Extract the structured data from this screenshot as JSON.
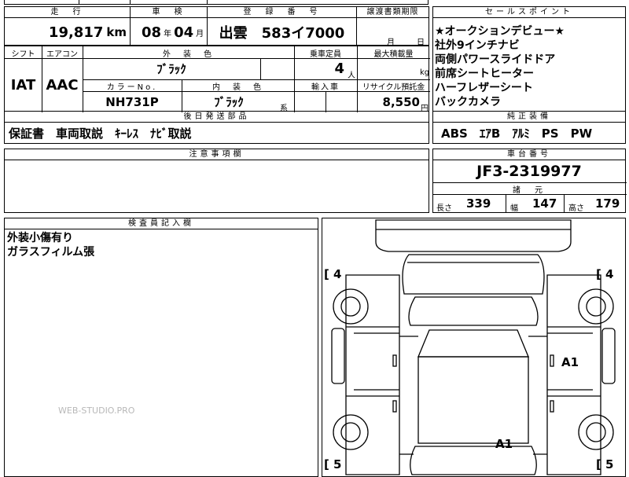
{
  "headers": {
    "mileage": "走　行",
    "inspection": "車　検",
    "registration": "登　録　番　号",
    "transfer_deadline": "譲渡書類期限",
    "sales_points": "セールスポイント",
    "shift": "シフト",
    "aircon": "エアコン",
    "exterior_color": "外　装　色",
    "capacity": "乗車定員",
    "max_load": "最大積載量",
    "color_no": "カラーNo.",
    "interior_color": "内　装　色",
    "import": "輸入車",
    "recycle": "リサイクル預託金",
    "later_parts": "後日発送部品",
    "genuine_equipment": "純正装備",
    "caution": "注意事項欄",
    "chassis_no": "車台番号",
    "specs": "諸　元",
    "inspector": "検査員記入欄"
  },
  "values": {
    "mileage": "19,817",
    "mileage_unit": "km",
    "inspection_year": "08",
    "year_unit": "年",
    "inspection_month": "04",
    "month_unit": "月",
    "registration": "出雲　583イ7000",
    "transfer_month_unit": "月",
    "transfer_day_unit": "日",
    "shift": "IAT",
    "aircon": "AAC",
    "exterior_color": "ﾌﾞﾗｯｸ",
    "capacity": "4",
    "capacity_unit": "人",
    "max_load_unit": "kg",
    "color_no": "NH731P",
    "interior_color": "ﾌﾞﾗｯｸ",
    "interior_suffix": "系",
    "recycle": "8,550",
    "recycle_unit": "円",
    "later_parts": "保証書　車両取説　ｷｰﾚｽ　ﾅﾋﾞ取説",
    "genuine_equipment": "ABS　ｴｱB　ｱﾙﾐ　PS　PW",
    "chassis_no": "JF3-2319977",
    "length_label": "長さ",
    "length": "339",
    "width_label": "幅",
    "width": "147",
    "height_label": "高さ",
    "height": "179"
  },
  "sales_points": [
    "★オークションデビュー★",
    "社外9インチナビ",
    "両側パワースライドドア",
    "前席シートヒーター",
    "ハーフレザーシート",
    "バックカメラ"
  ],
  "inspector_notes": [
    "外装小傷有り",
    "ガラスフィルム張"
  ],
  "diagram": {
    "tire_front_left": "4",
    "tire_front_right": "4",
    "tire_rear_left": "5",
    "tire_rear_right": "5",
    "bracket_open": "[",
    "mark_right_door": "A1",
    "mark_rear": "A1"
  },
  "watermark": "WEB-STUDIO.PRO"
}
